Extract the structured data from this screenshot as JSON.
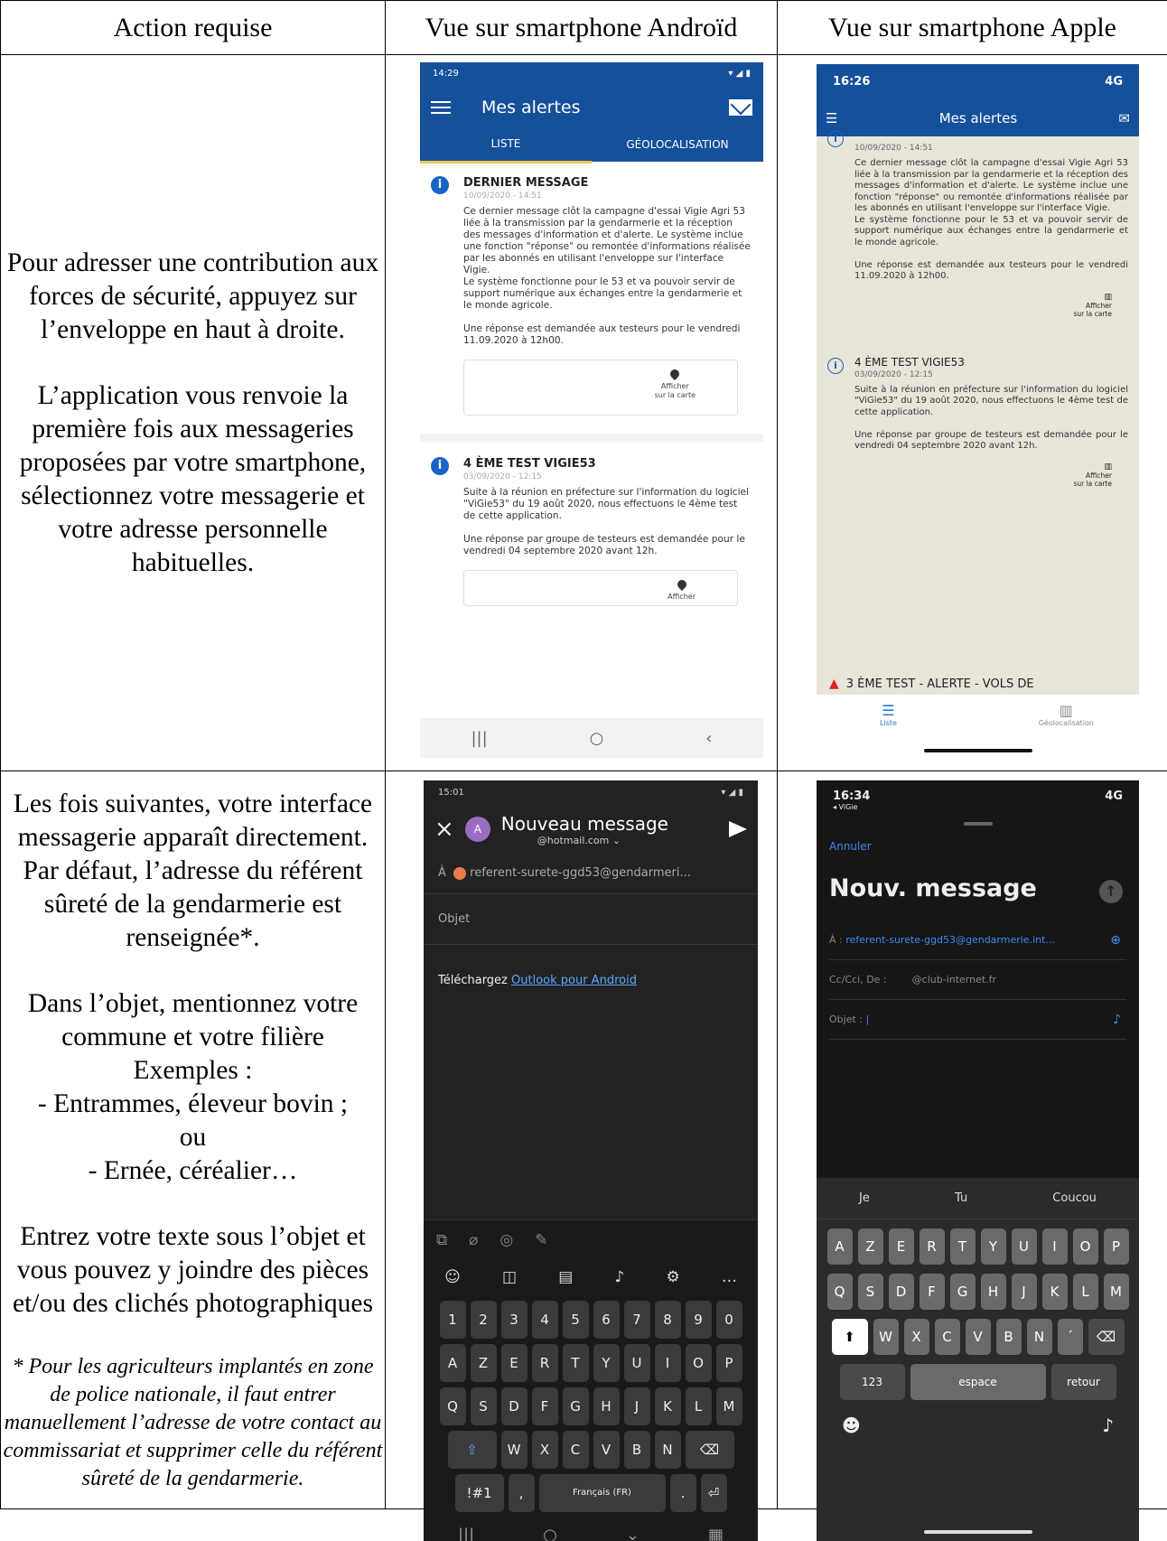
{
  "headers": {
    "col1": "Action requise",
    "col2": "Vue sur smartphone Androïd",
    "col3": "Vue sur smartphone Apple"
  },
  "row1": {
    "text1": "Pour adresser une contribution aux forces de sécurité, appuyez sur l’enveloppe en haut à droite.",
    "text2": "L’application vous renvoie la première fois aux messageries proposées par votre smartphone, sélectionnez votre messagerie et votre adresse personnelle habituelles."
  },
  "android_list": {
    "status_time": "14:29",
    "title": "Mes alertes",
    "tab_list": "LISTE",
    "tab_geo": "GÉOLOCALISATION",
    "msg1_title": "DERNIER MESSAGE",
    "msg1_date": "10/09/2020 - 14:51",
    "msg1_body": "Ce dernier message clôt la campagne d'essai Vigie Agri 53 liée à la transmission par la gendarmerie et la réception des messages d'information et d'alerte. Le système inclue une fonction \"réponse\" ou remontée d'informations réalisée par les abonnés en utilisant l'enveloppe sur l'interface Vigie.\nLe système fonctionne pour le 53 et va pouvoir servir de support numérique aux échanges entre la gendarmerie et le monde agricole.\n\nUne réponse est demandée aux testeurs pour le vendredi 11.09.2020 à 12h00.",
    "map_label": "Afficher",
    "map_label2": "sur la carte",
    "msg2_title": "4 ÈME TEST VIGIE53",
    "msg2_date": "03/09/2020 - 12:15",
    "msg2_body": "Suite à la réunion en préfecture sur l'information du logiciel \"ViGie53\" du 19 août 2020, nous effectuons le 4ème test de cette application.\n\nUne réponse par groupe de testeurs est demandée pour le vendredi 04 septembre 2020 avant 12h."
  },
  "ios_list": {
    "status_time": "16:26",
    "status_net": "4G",
    "title": "Mes alertes",
    "msg0_date": "10/09/2020 - 14:51",
    "msg3_title": "3 ÈME TEST - ALERTE - VOLS DE",
    "nav_list": "Liste",
    "nav_geo": "Géolocalisation"
  },
  "row2": {
    "p1": "Les fois suivantes, votre interface messagerie apparaît directement. Par défaut, l’adresse du référent sûreté de la gendarmerie est renseignée*.",
    "p2a": "Dans l’objet, mentionnez votre commune et votre filière",
    "p2b": "Exemples :",
    "p2c": "- Entrammes, éleveur bovin ;",
    "p2d": "ou",
    "p2e": "- Ernée, céréalier…",
    "p3": "Entrez votre texte sous l’objet et vous pouvez y joindre des pièces et/ou des clichés photographiques",
    "note": "* Pour les agriculteurs implantés en zone de police nationale, il faut entrer manuellement l’adresse de votre contact au commissariat et supprimer celle du référent sûreté de la gendarmerie."
  },
  "android_mail": {
    "status_time": "15:01",
    "title": "Nouveau message",
    "from": "@hotmail.com ⌄",
    "to_label": "À",
    "to": "referent-surete-ggd53@gendarmeri...",
    "subject": "Objet",
    "body_prefix": "Téléchargez ",
    "body_link": "Outlook pour Android",
    "row1": [
      "1",
      "2",
      "3",
      "4",
      "5",
      "6",
      "7",
      "8",
      "9",
      "0"
    ],
    "row2": [
      "A",
      "Z",
      "E",
      "R",
      "T",
      "Y",
      "U",
      "I",
      "O",
      "P"
    ],
    "row3": [
      "Q",
      "S",
      "D",
      "F",
      "G",
      "H",
      "J",
      "K",
      "L",
      "M"
    ],
    "row4": [
      "W",
      "X",
      "C",
      "V",
      "B",
      "N"
    ],
    "sym": "!#1",
    "comma": ",",
    "lang": "Français (FR)",
    "dot": "."
  },
  "ios_mail": {
    "status_time": "16:34",
    "back_app": "◂ ViGie",
    "status_net": "4G",
    "cancel": "Annuler",
    "title": "Nouv. message",
    "to_label": "À : ",
    "to": "referent-surete-ggd53@gendarmerie.int...",
    "cc_label": "Cc/Cci, De :",
    "cc": "@club-internet.fr",
    "subject_label": "Objet : ",
    "sugg": [
      "Je",
      "Tu",
      "Coucou"
    ],
    "row1": [
      "A",
      "Z",
      "E",
      "R",
      "T",
      "Y",
      "U",
      "I",
      "O",
      "P"
    ],
    "row2": [
      "Q",
      "S",
      "D",
      "F",
      "G",
      "H",
      "J",
      "K",
      "L",
      "M"
    ],
    "row3": [
      "W",
      "X",
      "C",
      "V",
      "B",
      "N",
      "´"
    ],
    "num": "123",
    "space": "espace",
    "ret": "retour"
  }
}
